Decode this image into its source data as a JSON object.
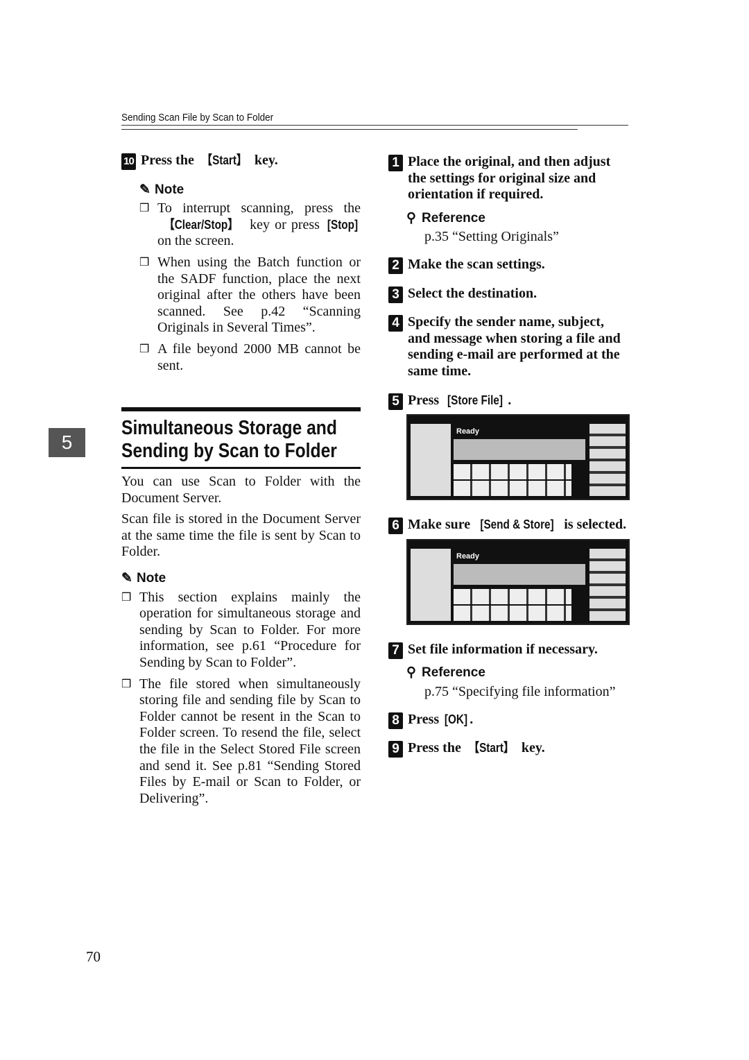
{
  "header": "Sending Scan File by Scan to Folder",
  "page_number": "70",
  "chapter_tab": "5",
  "left": {
    "step10": {
      "num": "10",
      "pre": "Press the ",
      "key": "【Start】",
      "post": " key."
    },
    "note_label": "Note",
    "notes1": [
      {
        "a": "To interrupt scanning, press the ",
        "k1": "【Clear/Stop】",
        "b": " key or press ",
        "k2": "[Stop]",
        "c": " on the screen."
      },
      {
        "a": "When using the Batch function or the SADF function, place the next original after the others have been scanned. See p.42 “Scanning Originals in Several Times”."
      },
      {
        "a": "A file beyond 2000 MB cannot be sent."
      }
    ],
    "section_title_1": "Simultaneous Storage and",
    "section_title_2": "Sending by Scan to Folder",
    "para1": "You can use Scan to Folder with the Document Server.",
    "para2": "Scan file is stored in the Document Server at the same time the file is sent by Scan to Folder.",
    "note2_label": "Note",
    "notes2": [
      "This section explains mainly the operation for simultaneous storage and sending by Scan to Folder. For more information, see p.61 “Procedure for Sending by Scan to Folder”.",
      "The file stored when simultaneously storing file and sending file by Scan to Folder cannot be resent in the Scan to Folder screen. To resend the file, select the file in the Select Stored File screen and send it. See p.81 “Sending Stored Files by E-mail or Scan to Folder, or Delivering”."
    ]
  },
  "right": {
    "s1": {
      "num": "1",
      "text": "Place the original, and then adjust the settings for original size and orientation if required."
    },
    "ref_label": "Reference",
    "ref1": "p.35 “Setting Originals”",
    "s2": {
      "num": "2",
      "text": "Make the scan settings."
    },
    "s3": {
      "num": "3",
      "text": "Select the destination."
    },
    "s4": {
      "num": "4",
      "text": "Specify the sender name, subject, and message when storing a file and sending e-mail are performed at the same time."
    },
    "s5": {
      "num": "5",
      "pre": "Press ",
      "key": "[Store File]",
      "post": "."
    },
    "screen_title": "Ready",
    "s6": {
      "num": "6",
      "pre": "Make sure ",
      "key": "[Send & Store]",
      "post": " is selected."
    },
    "s7": {
      "num": "7",
      "text": "Set file information if necessary."
    },
    "ref2": "p.75 “Specifying file information”",
    "s8": {
      "num": "8",
      "pre": "Press ",
      "key": "[OK]",
      "post": "."
    },
    "s9": {
      "num": "9",
      "pre": "Press the ",
      "key": "【Start】",
      "post": " key."
    }
  }
}
